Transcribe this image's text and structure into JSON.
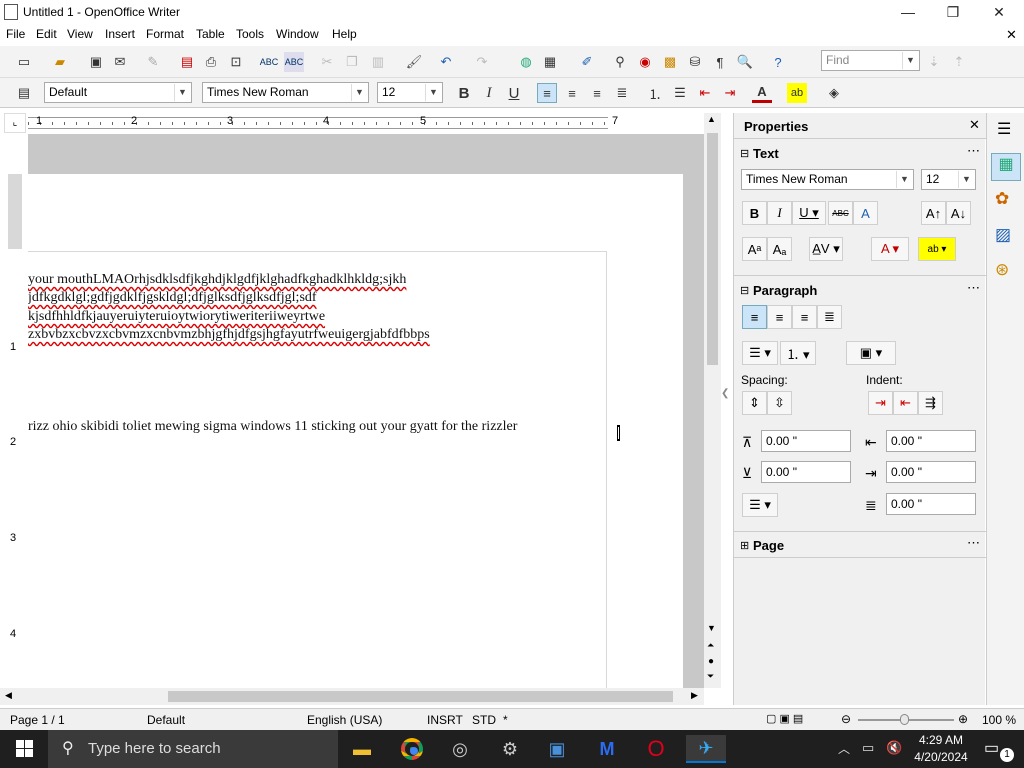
{
  "window": {
    "title": "Untitled 1 - OpenOffice Writer",
    "minimize": "—",
    "restore": "❐",
    "close": "✕",
    "doc_close": "✕"
  },
  "menu": [
    "File",
    "Edit",
    "View",
    "Insert",
    "Format",
    "Table",
    "Tools",
    "Window",
    "Help"
  ],
  "toolbar": {
    "find_placeholder": "Find"
  },
  "formatting": {
    "style": "Default",
    "font": "Times New Roman",
    "size": "12",
    "bold": "B",
    "italic": "I",
    "underline": "U"
  },
  "ruler": {
    "h_labels": [
      "1",
      "2",
      "3",
      "4",
      "5",
      "7"
    ],
    "v_labels": [
      "1",
      "2",
      "3",
      "4"
    ]
  },
  "document": {
    "lines": [
      "your mouthLMAOrhjsdklsdfjkghdjklgdfjklghadfkghadklhkldg;sjkh",
      "jdfkgdklgl;gdfjgdklfjgskldgl;dfjglksdfjglksdfjgl;sdf",
      "kjsdfhhldfkjauyeruiyteruioytwiorytiweriteriiweyrtwe",
      "zxbvbzxcbvzxcbvmzxcnbvmzbhjgfhjdfgsjhgfayutrfweuigergjabfdfbbps",
      "rizz ohio skibidi toliet mewing sigma windows 11 sticking out your gyatt for the rizzler"
    ]
  },
  "sidebar": {
    "title": "Properties",
    "text_section": "Text",
    "font": "Times New Roman",
    "size": "12",
    "paragraph_section": "Paragraph",
    "spacing_label": "Spacing:",
    "indent_label": "Indent:",
    "spacing_above": "0.00 \"",
    "spacing_below": "0.00 \"",
    "indent_before": "0.00 \"",
    "indent_after": "0.00 \"",
    "first_line": "0.00 \"",
    "page_section": "Page"
  },
  "status": {
    "page": "Page 1 / 1",
    "style": "Default",
    "language": "English (USA)",
    "insert": "INSRT",
    "selection": "STD",
    "modified": "*",
    "zoom": "100 %"
  },
  "taskbar": {
    "search_placeholder": "Type here to search",
    "time": "4:29 AM",
    "date": "4/20/2024",
    "notifications": "1"
  },
  "colors": {
    "accent": "#0078d7",
    "font_color": "#c00000",
    "highlight": "#ffff00",
    "selected_align": "#cce4f7"
  }
}
